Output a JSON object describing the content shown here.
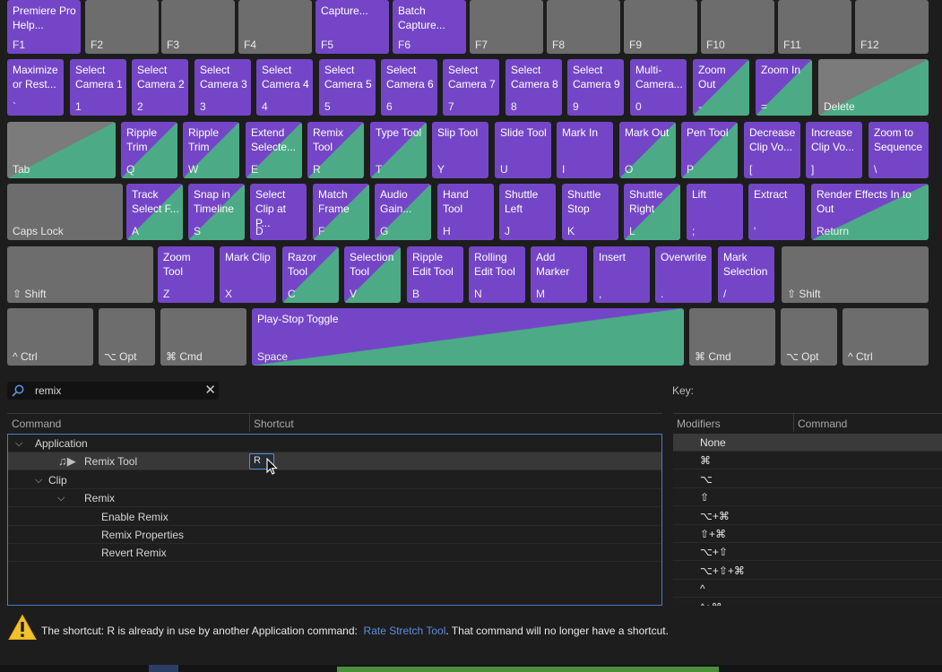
{
  "keyboard": {
    "rows": [
      [
        {
          "label": "Premiere Pro\nHelp...",
          "cap": "F1",
          "style": "cmd"
        },
        {
          "label": "",
          "cap": "F2",
          "style": "plain"
        },
        {
          "label": "",
          "cap": "F3",
          "style": "plain"
        },
        {
          "label": "",
          "cap": "F4",
          "style": "plain"
        },
        {
          "label": "Capture...",
          "cap": "F5",
          "style": "cmd"
        },
        {
          "label": "Batch\nCapture...",
          "cap": "F6",
          "style": "cmd"
        },
        {
          "label": "",
          "cap": "F7",
          "style": "plain"
        },
        {
          "label": "",
          "cap": "F8",
          "style": "plain"
        },
        {
          "label": "",
          "cap": "F9",
          "style": "plain"
        },
        {
          "label": "",
          "cap": "F10",
          "style": "plain"
        },
        {
          "label": "",
          "cap": "F11",
          "style": "plain"
        },
        {
          "label": "",
          "cap": "F12",
          "style": "plain"
        }
      ],
      [
        {
          "label": "Maximize\nor Rest...",
          "cap": "`",
          "style": "cmd"
        },
        {
          "label": "Select\nCamera 1",
          "cap": "1",
          "style": "cmd"
        },
        {
          "label": "Select\nCamera 2",
          "cap": "2",
          "style": "cmd"
        },
        {
          "label": "Select\nCamera 3",
          "cap": "3",
          "style": "cmd"
        },
        {
          "label": "Select\nCamera 4",
          "cap": "4",
          "style": "cmd"
        },
        {
          "label": "Select\nCamera 5",
          "cap": "5",
          "style": "cmd"
        },
        {
          "label": "Select\nCamera 6",
          "cap": "6",
          "style": "cmd"
        },
        {
          "label": "Select\nCamera 7",
          "cap": "7",
          "style": "cmd"
        },
        {
          "label": "Select\nCamera 8",
          "cap": "8",
          "style": "cmd"
        },
        {
          "label": "Select\nCamera 9",
          "cap": "9",
          "style": "cmd"
        },
        {
          "label": "Multi-\nCamera...",
          "cap": "0",
          "style": "cmd"
        },
        {
          "label": "Zoom Out",
          "cap": "-",
          "style": "tri"
        },
        {
          "label": "Zoom In",
          "cap": "=",
          "style": "tri"
        },
        {
          "label": "",
          "cap": "Delete",
          "style": "gtri"
        }
      ],
      [
        {
          "label": "",
          "cap": "Tab",
          "style": "gtri"
        },
        {
          "label": "Ripple\nTrim",
          "cap": "Q",
          "style": "tri"
        },
        {
          "label": "Ripple\nTrim",
          "cap": "W",
          "style": "tri"
        },
        {
          "label": "Extend\nSelecte...",
          "cap": "E",
          "style": "tri"
        },
        {
          "label": "Remix\nTool",
          "cap": "R",
          "style": "tri"
        },
        {
          "label": "Type Tool",
          "cap": "T",
          "style": "tri"
        },
        {
          "label": "Slip Tool",
          "cap": "Y",
          "style": "cmd"
        },
        {
          "label": "Slide Tool",
          "cap": "U",
          "style": "cmd"
        },
        {
          "label": "Mark In",
          "cap": "I",
          "style": "cmd"
        },
        {
          "label": "Mark Out",
          "cap": "O",
          "style": "tri"
        },
        {
          "label": "Pen Tool",
          "cap": "P",
          "style": "tri"
        },
        {
          "label": "Decrease\nClip Vo...",
          "cap": "[",
          "style": "cmd"
        },
        {
          "label": "Increase\nClip Vo...",
          "cap": "]",
          "style": "cmd"
        },
        {
          "label": "Zoom to\nSequence",
          "cap": "\\",
          "style": "cmd"
        }
      ],
      [
        {
          "label": "",
          "cap": "Caps Lock",
          "style": "plain"
        },
        {
          "label": "Track\nSelect F...",
          "cap": "A",
          "style": "tri"
        },
        {
          "label": "Snap in\nTimeline",
          "cap": "S",
          "style": "tri"
        },
        {
          "label": "Select\nClip at P...",
          "cap": "D",
          "style": "cmd"
        },
        {
          "label": "Match\nFrame",
          "cap": "F",
          "style": "tri"
        },
        {
          "label": "Audio\nGain...",
          "cap": "G",
          "style": "tri"
        },
        {
          "label": "Hand Tool",
          "cap": "H",
          "style": "cmd"
        },
        {
          "label": "Shuttle\nLeft",
          "cap": "J",
          "style": "cmd"
        },
        {
          "label": "Shuttle\nStop",
          "cap": "K",
          "style": "cmd"
        },
        {
          "label": "Shuttle\nRight",
          "cap": "L",
          "style": "tri"
        },
        {
          "label": "Lift",
          "cap": ";",
          "style": "cmd"
        },
        {
          "label": "Extract",
          "cap": "'",
          "style": "cmd"
        },
        {
          "label": "Render Effects In to\nOut",
          "cap": "Return",
          "style": "tri"
        }
      ],
      [
        {
          "label": "",
          "cap": "⇧ Shift",
          "style": "plain"
        },
        {
          "label": "Zoom\nTool",
          "cap": "Z",
          "style": "cmd"
        },
        {
          "label": "Mark Clip",
          "cap": "X",
          "style": "cmd"
        },
        {
          "label": "Razor\nTool",
          "cap": "C",
          "style": "tri"
        },
        {
          "label": "Selection\nTool",
          "cap": "V",
          "style": "tri"
        },
        {
          "label": "Ripple\nEdit Tool",
          "cap": "B",
          "style": "cmd"
        },
        {
          "label": "Rolling\nEdit Tool",
          "cap": "N",
          "style": "cmd"
        },
        {
          "label": "Add\nMarker",
          "cap": "M",
          "style": "cmd"
        },
        {
          "label": "Insert",
          "cap": ",",
          "style": "cmd"
        },
        {
          "label": "Overwrite",
          "cap": ".",
          "style": "cmd"
        },
        {
          "label": "Mark\nSelection",
          "cap": "/",
          "style": "cmd"
        },
        {
          "label": "",
          "cap": "⇧ Shift",
          "style": "plain"
        }
      ],
      [
        {
          "label": "",
          "cap": "^ Ctrl",
          "style": "plain"
        },
        {
          "label": "",
          "cap": "⌥ Opt",
          "style": "plain"
        },
        {
          "label": "",
          "cap": "⌘ Cmd",
          "style": "plain"
        },
        {
          "label": "Play-Stop Toggle",
          "cap": "Space",
          "style": "tri"
        },
        {
          "label": "",
          "cap": "⌘ Cmd",
          "style": "plain"
        },
        {
          "label": "",
          "cap": "⌥ Opt",
          "style": "plain"
        },
        {
          "label": "",
          "cap": "^ Ctrl",
          "style": "plain"
        }
      ]
    ]
  },
  "search": {
    "value": "remix",
    "icon": "search-icon",
    "clear_icon": "clear-icon",
    "clear_glyph": "✕"
  },
  "key_panel": {
    "label": "Key:"
  },
  "command_table": {
    "headers": {
      "command": "Command",
      "shortcut": "Shortcut"
    },
    "rows": [
      {
        "text": "Application",
        "level": 0,
        "expanded": true,
        "type": "group"
      },
      {
        "text": "Remix Tool",
        "level": 2,
        "type": "command",
        "selected": true,
        "shortcut": "R",
        "icon": "remix-tool-icon"
      },
      {
        "text": "Clip",
        "level": 1,
        "expanded": true,
        "type": "group"
      },
      {
        "text": "Remix",
        "level": 2,
        "expanded": true,
        "type": "group"
      },
      {
        "text": "Enable Remix",
        "level": 3,
        "type": "command"
      },
      {
        "text": "Remix Properties",
        "level": 3,
        "type": "command"
      },
      {
        "text": "Revert Remix",
        "level": 3,
        "type": "command"
      }
    ]
  },
  "modifier_table": {
    "headers": {
      "modifiers": "Modifiers",
      "command": "Command"
    },
    "rows": [
      "None",
      "⌘",
      "⌥",
      "⇧",
      "⌥+⌘",
      "⇧+⌘",
      "⌥+⇧",
      "⌥+⇧+⌘",
      "^",
      "^+⌘"
    ]
  },
  "warning": {
    "icon": "warning-icon",
    "prefix": "The shortcut: R is already in use by another Application command:  ",
    "link": "Rate Stretch Tool",
    "suffix": ". That command will no longer have a shortcut."
  },
  "colors": {
    "command_purple": "#7446c7",
    "panel_green": "#4cab86",
    "unassigned_gray": "#6d6d6d",
    "link_blue": "#5b8fe0",
    "focus_blue": "#4f79c7"
  }
}
